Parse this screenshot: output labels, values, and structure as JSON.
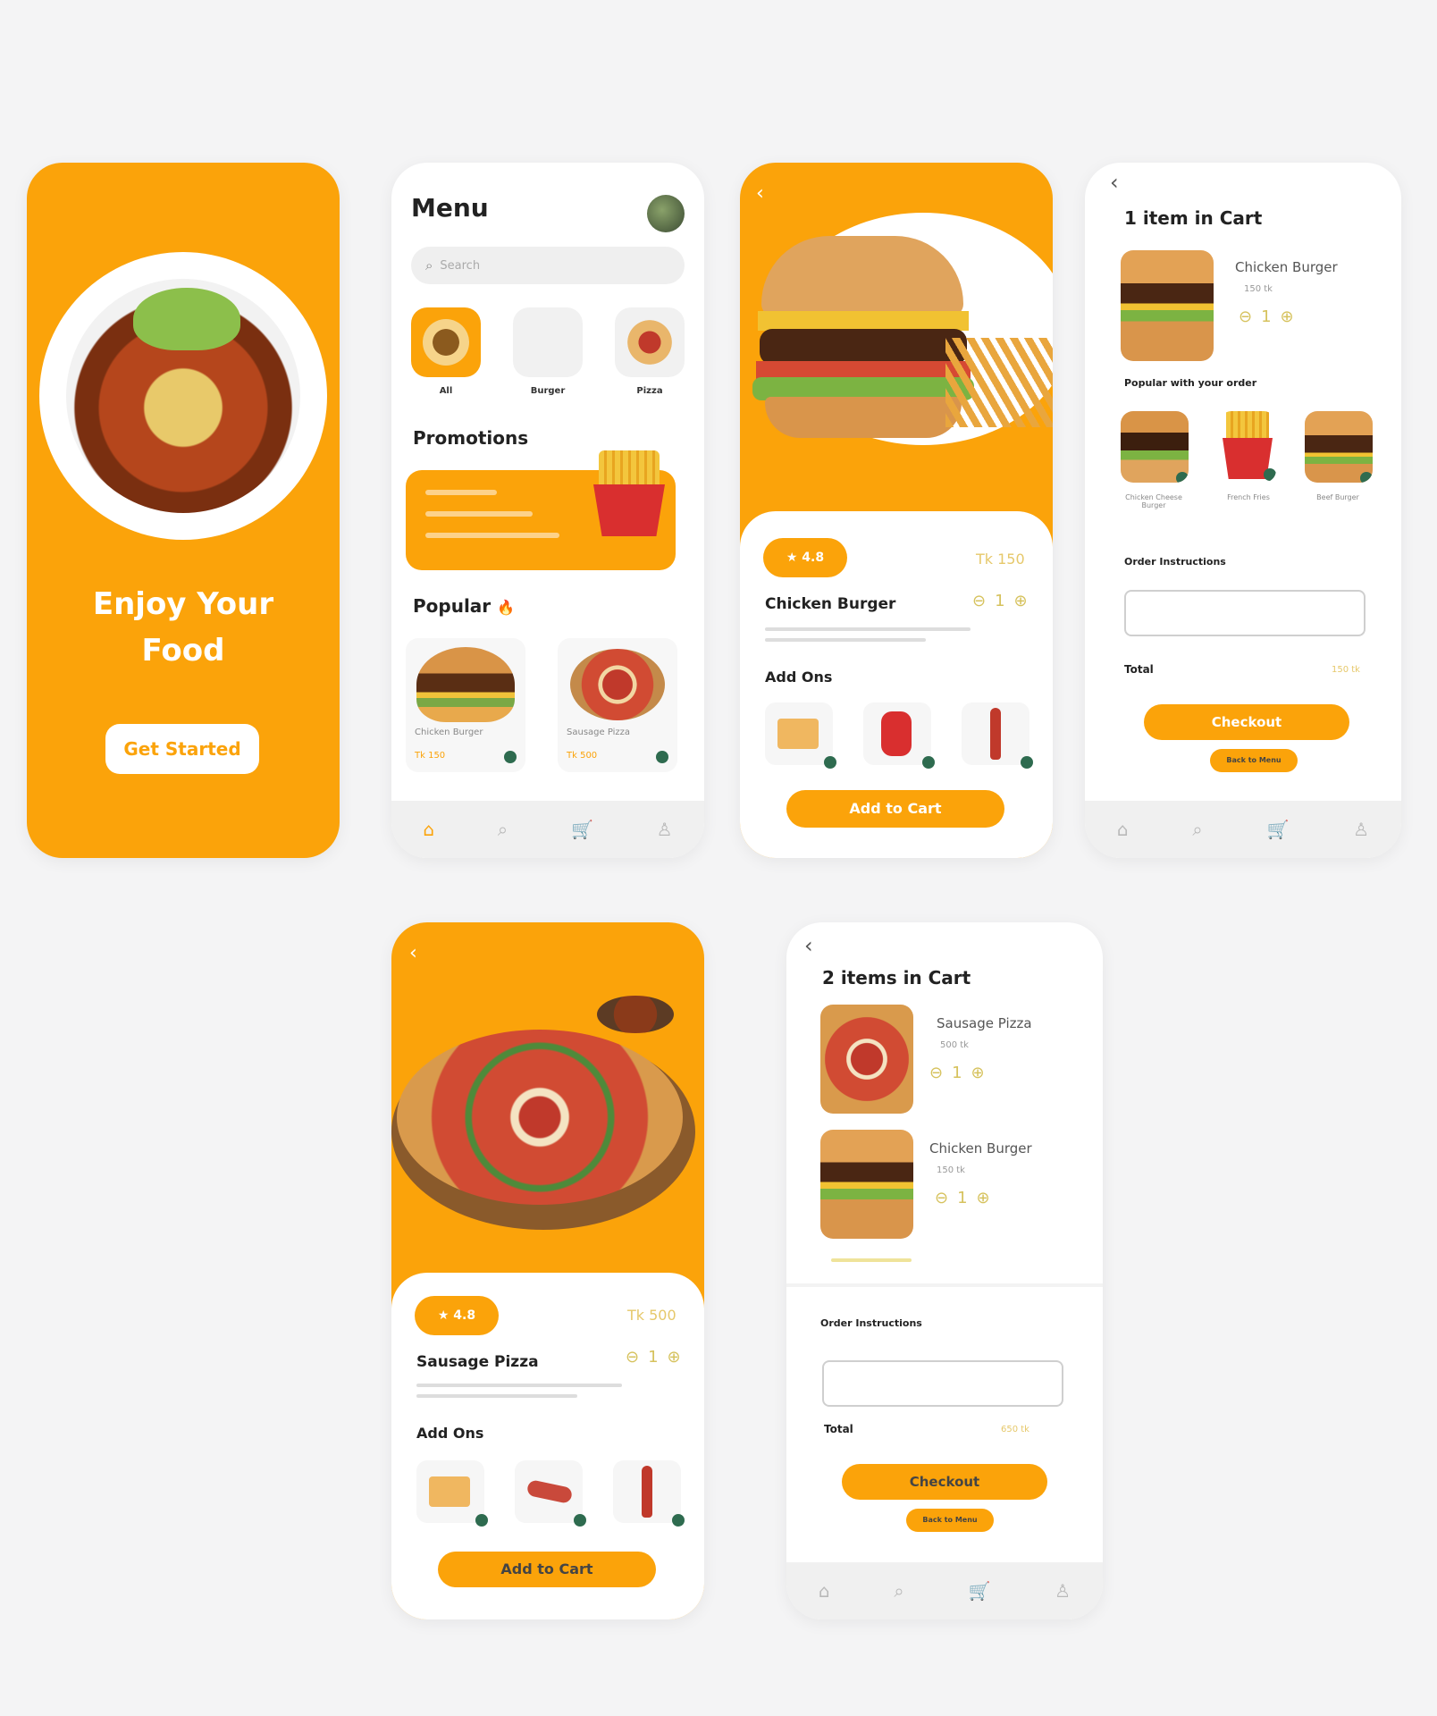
{
  "splash": {
    "headline": "Enjoy Your Food",
    "cta": "Get Started"
  },
  "menu": {
    "title": "Menu",
    "search_placeholder": "Search",
    "categories": [
      "All",
      "Burger",
      "Pizza"
    ],
    "promotions_title": "Promotions",
    "popular_title": "Popular",
    "popular_items": [
      {
        "name": "Chicken Burger",
        "price": "Tk 150"
      },
      {
        "name": "Sausage Pizza",
        "price": "Tk 500"
      }
    ]
  },
  "burger_detail": {
    "rating": "★ 4.8",
    "price": "Tk 150",
    "name": "Chicken Burger",
    "qty": "1",
    "addons_title": "Add Ons",
    "add_to_cart": "Add to Cart"
  },
  "cart1": {
    "title": "1 item in Cart",
    "item_name": "Chicken Burger",
    "item_price": "150 tk",
    "qty": "1",
    "popular_title": "Popular with your order",
    "suggestions": [
      "Chicken Cheese Burger",
      "French Fries",
      "Beef Burger"
    ],
    "instructions_label": "Order Instructions",
    "total_label": "Total",
    "total_value": "150 tk",
    "checkout": "Checkout",
    "back": "Back to Menu"
  },
  "pizza_detail": {
    "rating": "★ 4.8",
    "price": "Tk 500",
    "name": "Sausage Pizza",
    "qty": "1",
    "addons_title": "Add Ons",
    "add_to_cart": "Add to Cart"
  },
  "cart2": {
    "title": "2 items in Cart",
    "items": [
      {
        "name": "Sausage Pizza",
        "price": "500 tk",
        "qty": "1"
      },
      {
        "name": "Chicken Burger",
        "price": "150 tk",
        "qty": "1"
      }
    ],
    "instructions_label": "Order Instructions",
    "total_label": "Total",
    "total_value": "650 tk",
    "checkout": "Checkout",
    "back": "Back to Menu"
  },
  "icons": {
    "home": "home-icon",
    "search": "search-icon",
    "cart": "cart-icon",
    "profile": "profile-icon"
  },
  "colors": {
    "accent": "#fba30a",
    "addon_badge": "#2e6b4f"
  }
}
